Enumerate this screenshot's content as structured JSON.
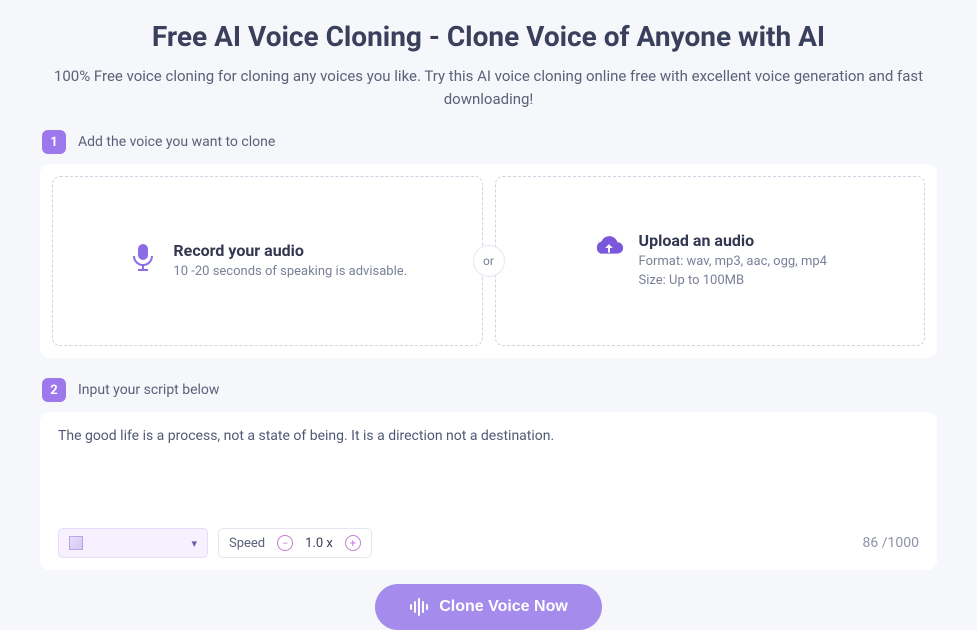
{
  "header": {
    "title": "Free AI Voice Cloning - Clone Voice of Anyone with AI",
    "subtitle": "100% Free voice cloning for cloning any voices you like. Try this AI voice cloning online free with excellent voice generation and fast downloading!"
  },
  "step1": {
    "badge": "1",
    "label": "Add the voice you want to clone",
    "record": {
      "title": "Record your audio",
      "hint": "10 -20 seconds of speaking is advisable."
    },
    "or": "or",
    "upload": {
      "title": "Upload an audio",
      "line1": "Format: wav, mp3, aac, ogg, mp4",
      "line2": "Size: Up to 100MB"
    }
  },
  "step2": {
    "badge": "2",
    "label": "Input your script below",
    "script": "The good life is a process, not a state of being. It is a direction not a destination.",
    "speed_label": "Speed",
    "speed_value": "1.0 x",
    "counter": "86 /1000"
  },
  "cta": {
    "label": "Clone Voice Now"
  }
}
